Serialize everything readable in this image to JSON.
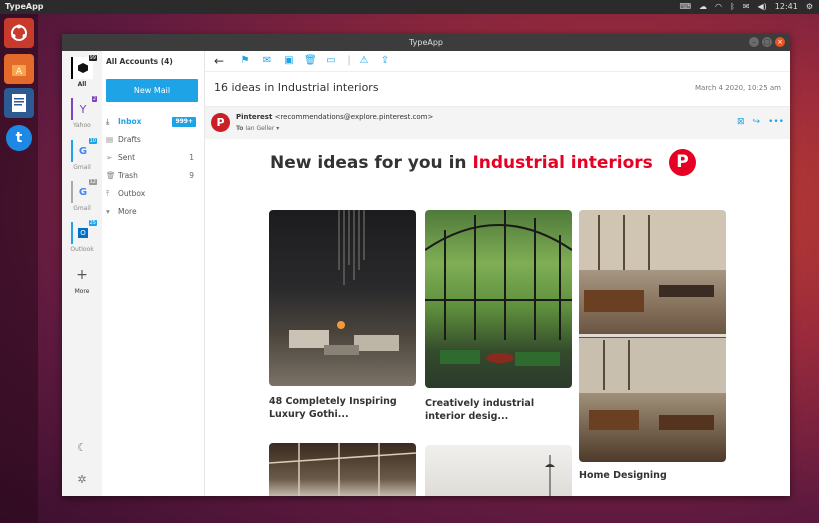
{
  "topbar": {
    "app_name": "TypeApp",
    "time": "12:41"
  },
  "window": {
    "title": "TypeApp"
  },
  "accounts": [
    {
      "label": "All",
      "badge": "99"
    },
    {
      "label": "Yahoo",
      "badge": "2"
    },
    {
      "label": "Gmail",
      "badge": "10"
    },
    {
      "label": "Gmail",
      "badge": "12"
    },
    {
      "label": "Outlook",
      "badge": "25"
    },
    {
      "label": "More"
    }
  ],
  "folders": {
    "header": "All Accounts (4)",
    "new_mail": "New Mail",
    "items": [
      {
        "label": "Inbox",
        "count": "999+"
      },
      {
        "label": "Drafts",
        "count": ""
      },
      {
        "label": "Sent",
        "count": "1"
      },
      {
        "label": "Trash",
        "count": "9"
      },
      {
        "label": "Outbox",
        "count": ""
      },
      {
        "label": "More",
        "count": ""
      }
    ]
  },
  "message": {
    "subject": "16 ideas in Industrial interiors",
    "date": "March 4 2020, 10:25 am",
    "sender_name": "Pinterest",
    "sender_email": "<recommendations@explore.pinterest.com>",
    "to_label": "To",
    "to_name": "Ian Geller"
  },
  "email_body": {
    "headline_prefix": "New ideas for you in ",
    "headline_highlight": "Industrial interiors",
    "cards": [
      {
        "caption": "48 Completely Inspiring Luxury Gothi..."
      },
      {
        "caption": "Creatively industrial interior desig..."
      },
      {
        "caption": "Home Designing"
      }
    ]
  },
  "colors": {
    "accent": "#1ea3e6",
    "pinterest_red": "#e60023",
    "ubuntu_orange": "#e95420"
  }
}
